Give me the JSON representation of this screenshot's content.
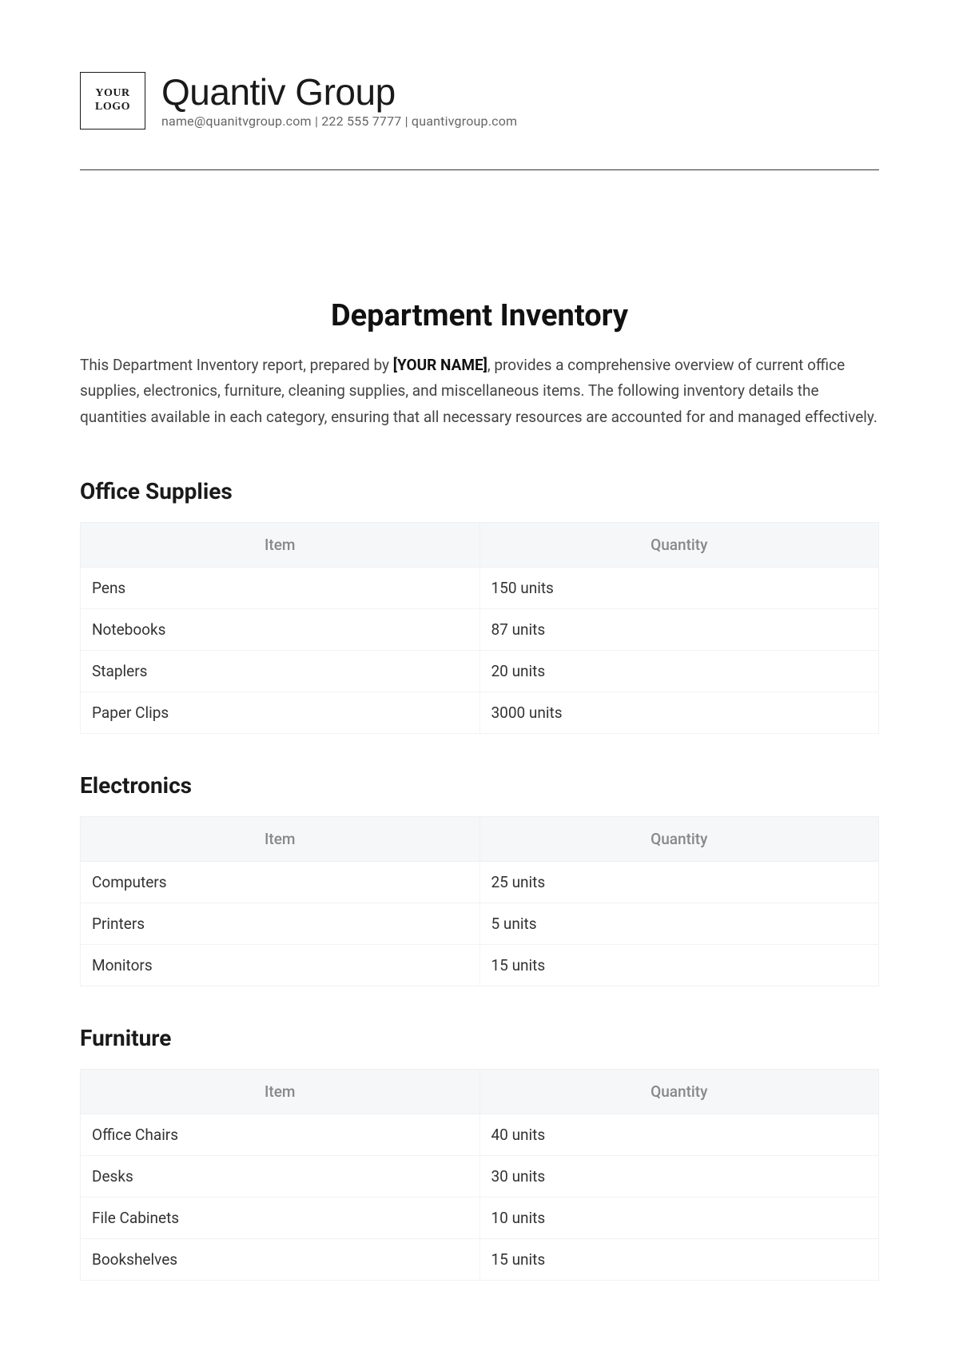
{
  "header": {
    "logo_line1": "YOUR",
    "logo_line2": "LOGO",
    "company_name": "Quantiv Group",
    "contact_line": "name@quanitvgroup.com | 222 555 7777 | quantivgroup.com"
  },
  "title": "Department Inventory",
  "intro": {
    "text_before": "This Department Inventory report, prepared by ",
    "placeholder": "[YOUR NAME]",
    "text_after": ", provides a comprehensive overview of current office supplies, electronics, furniture, cleaning supplies, and miscellaneous items. The following inventory details the quantities available in each category, ensuring that all necessary resources are accounted for and managed effectively."
  },
  "table_headers": {
    "item": "Item",
    "quantity": "Quantity"
  },
  "sections": [
    {
      "title": "Office Supplies",
      "rows": [
        {
          "item": "Pens",
          "quantity": "150 units"
        },
        {
          "item": "Notebooks",
          "quantity": "87 units"
        },
        {
          "item": "Staplers",
          "quantity": "20 units"
        },
        {
          "item": "Paper Clips",
          "quantity": "3000 units"
        }
      ]
    },
    {
      "title": "Electronics",
      "rows": [
        {
          "item": "Computers",
          "quantity": "25 units"
        },
        {
          "item": "Printers",
          "quantity": "5 units"
        },
        {
          "item": "Monitors",
          "quantity": "15 units"
        }
      ]
    },
    {
      "title": "Furniture",
      "rows": [
        {
          "item": "Office Chairs",
          "quantity": "40 units"
        },
        {
          "item": "Desks",
          "quantity": "30 units"
        },
        {
          "item": "File Cabinets",
          "quantity": "10 units"
        },
        {
          "item": "Bookshelves",
          "quantity": "15 units"
        }
      ]
    }
  ]
}
